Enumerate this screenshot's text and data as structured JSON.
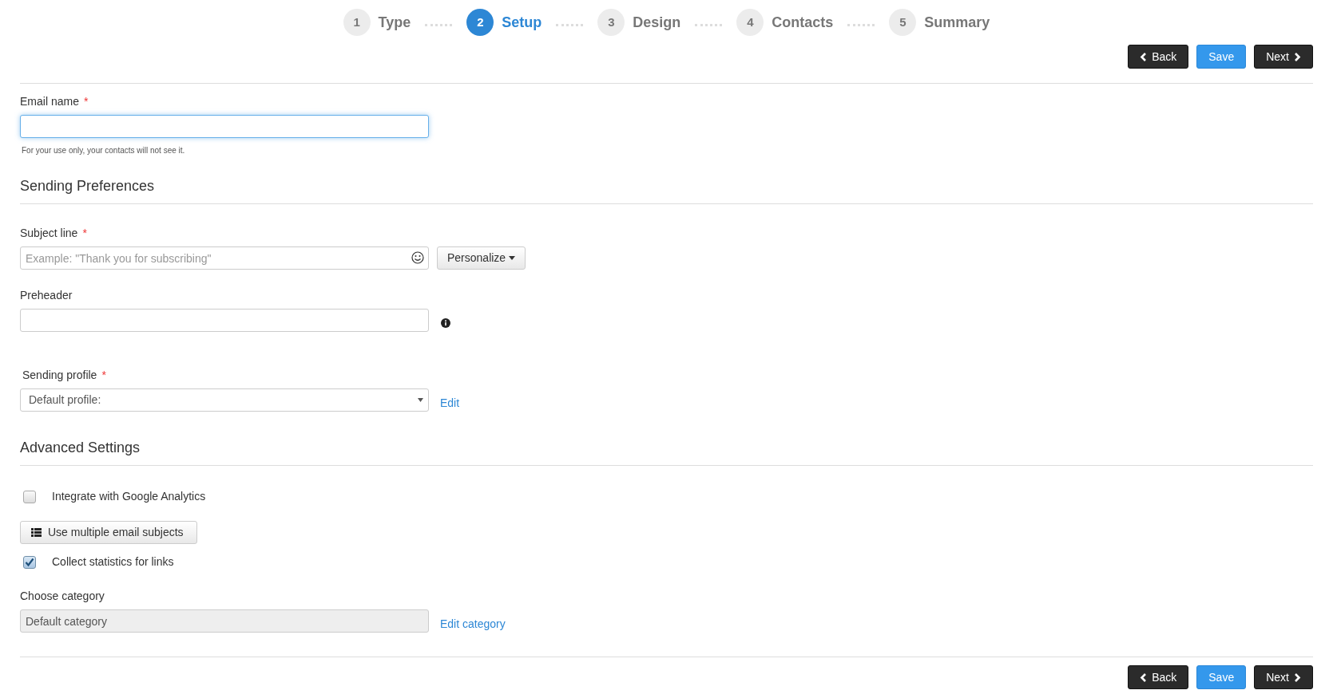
{
  "steps": [
    {
      "number": "1",
      "label": "Type",
      "selected": false
    },
    {
      "number": "2",
      "label": "Setup",
      "selected": true
    },
    {
      "number": "3",
      "label": "Design",
      "selected": false
    },
    {
      "number": "4",
      "label": "Contacts",
      "selected": false
    },
    {
      "number": "5",
      "label": "Summary",
      "selected": false
    }
  ],
  "top_actions": [
    {
      "kind": "back",
      "label": "Back"
    },
    {
      "kind": "save",
      "label": "Save"
    },
    {
      "kind": "next",
      "label": "Next"
    }
  ],
  "email_name": {
    "label": "Email name",
    "required_mark": "*",
    "focused": true,
    "help": "For your use only, your contacts will not see it."
  },
  "sending_preferences": {
    "title": "Sending Preferences",
    "subject_line": {
      "label": "Subject line",
      "required_mark": "*",
      "placeholder": "Example: \"Thank you for subscribing\"",
      "personalize_button": "Personalize"
    },
    "preheader": {
      "label": "Preheader"
    },
    "sending_profile": {
      "label": "Sending profile",
      "required_mark": "*",
      "value": "Default profile:",
      "edit_link": "Edit"
    }
  },
  "advanced_settings": {
    "title": "Advanced Settings",
    "google_analytics": {
      "label": "Integrate with Google Analytics",
      "checked": false
    },
    "multiple_subjects_button": "Use multiple email subjects",
    "collect_statistics": {
      "label": "Collect statistics for links",
      "checked": true
    },
    "category": {
      "label": "Choose category",
      "value": "Default category",
      "disabled": true,
      "edit_link": "Edit category"
    }
  },
  "bottom_actions": [
    {
      "kind": "back",
      "label": "Back"
    },
    {
      "kind": "save",
      "label": "Save"
    },
    {
      "kind": "next",
      "label": "Next"
    }
  ]
}
